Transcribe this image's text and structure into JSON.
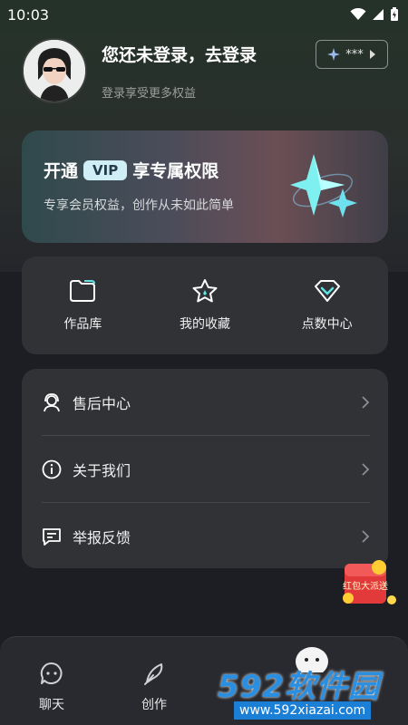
{
  "status": {
    "time": "10:03"
  },
  "profile": {
    "title": "您还未登录，去登录",
    "subtitle": "登录享受更多权益",
    "points": "***"
  },
  "vip": {
    "prefix": "开通",
    "badge": "VIP",
    "suffix": "享专属权限",
    "subtitle": "专享会员权益，创作从未如此简单"
  },
  "quick": [
    {
      "label": "作品库",
      "icon": "folder-icon"
    },
    {
      "label": "我的收藏",
      "icon": "star-icon"
    },
    {
      "label": "点数中心",
      "icon": "diamond-icon"
    }
  ],
  "menu": [
    {
      "label": "售后中心",
      "icon": "headset-icon"
    },
    {
      "label": "关于我们",
      "icon": "info-icon"
    },
    {
      "label": "举报反馈",
      "icon": "feedback-icon"
    }
  ],
  "floating": {
    "text": "红包大派送"
  },
  "nav": [
    {
      "label": "聊天",
      "icon": "chat-icon"
    },
    {
      "label": "创作",
      "icon": "feather-icon"
    }
  ],
  "watermark": {
    "big": "592软件园",
    "small": "www.592xiazai.com"
  },
  "colors": {
    "accent": "#5fe3e3",
    "card": "#303236",
    "background": "#1d1e24"
  }
}
